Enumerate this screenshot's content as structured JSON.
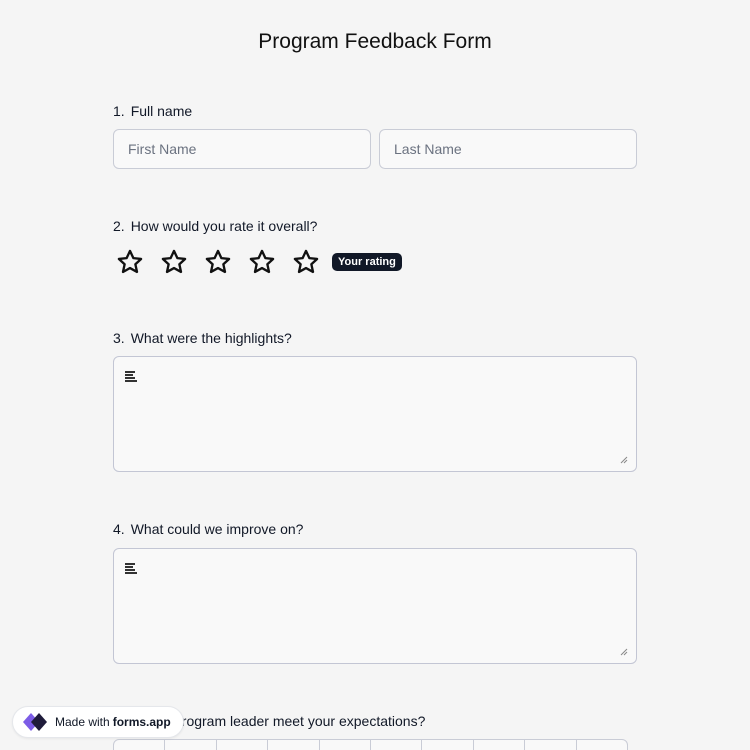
{
  "form": {
    "title": "Program Feedback Form"
  },
  "questions": [
    {
      "number": "1.",
      "label": "Full name"
    },
    {
      "number": "2.",
      "label": "How would you rate it overall?"
    },
    {
      "number": "3.",
      "label": "What were the highlights?"
    },
    {
      "number": "4.",
      "label": "What could we improve on?"
    },
    {
      "number": "",
      "label": "program leader meet your expectations?"
    }
  ],
  "full_name": {
    "first_placeholder": "First Name",
    "last_placeholder": "Last Name"
  },
  "rating": {
    "max": 5,
    "value": 0,
    "badge": "Your rating"
  },
  "branding": {
    "prefix": "Made with",
    "brand": "forms.app"
  },
  "colors": {
    "accent_dark": "#111827",
    "logo_purple": "#7c5ce6"
  }
}
